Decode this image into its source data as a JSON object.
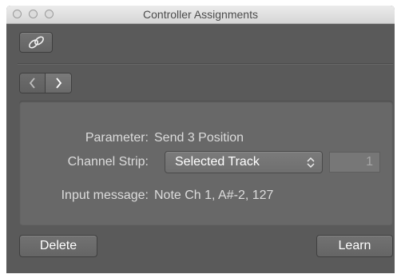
{
  "window": {
    "title": "Controller Assignments"
  },
  "toolbar": {
    "link_icon": "link-icon"
  },
  "navigation": {
    "back_icon": "chevron-left-icon",
    "forward_icon": "chevron-right-icon"
  },
  "details": {
    "parameter_label": "Parameter:",
    "parameter_value": "Send 3 Position",
    "channel_strip_label": "Channel Strip:",
    "channel_strip_value": "Selected Track",
    "channel_strip_number": "1",
    "input_message_label": "Input message:",
    "input_message_value": "Note Ch 1, A#-2, 127"
  },
  "actions": {
    "delete_label": "Delete",
    "learn_label": "Learn"
  },
  "colors": {
    "window_bg": "#5a5a5a",
    "panel_bg": "#686868",
    "text": "#dcdcdc"
  }
}
